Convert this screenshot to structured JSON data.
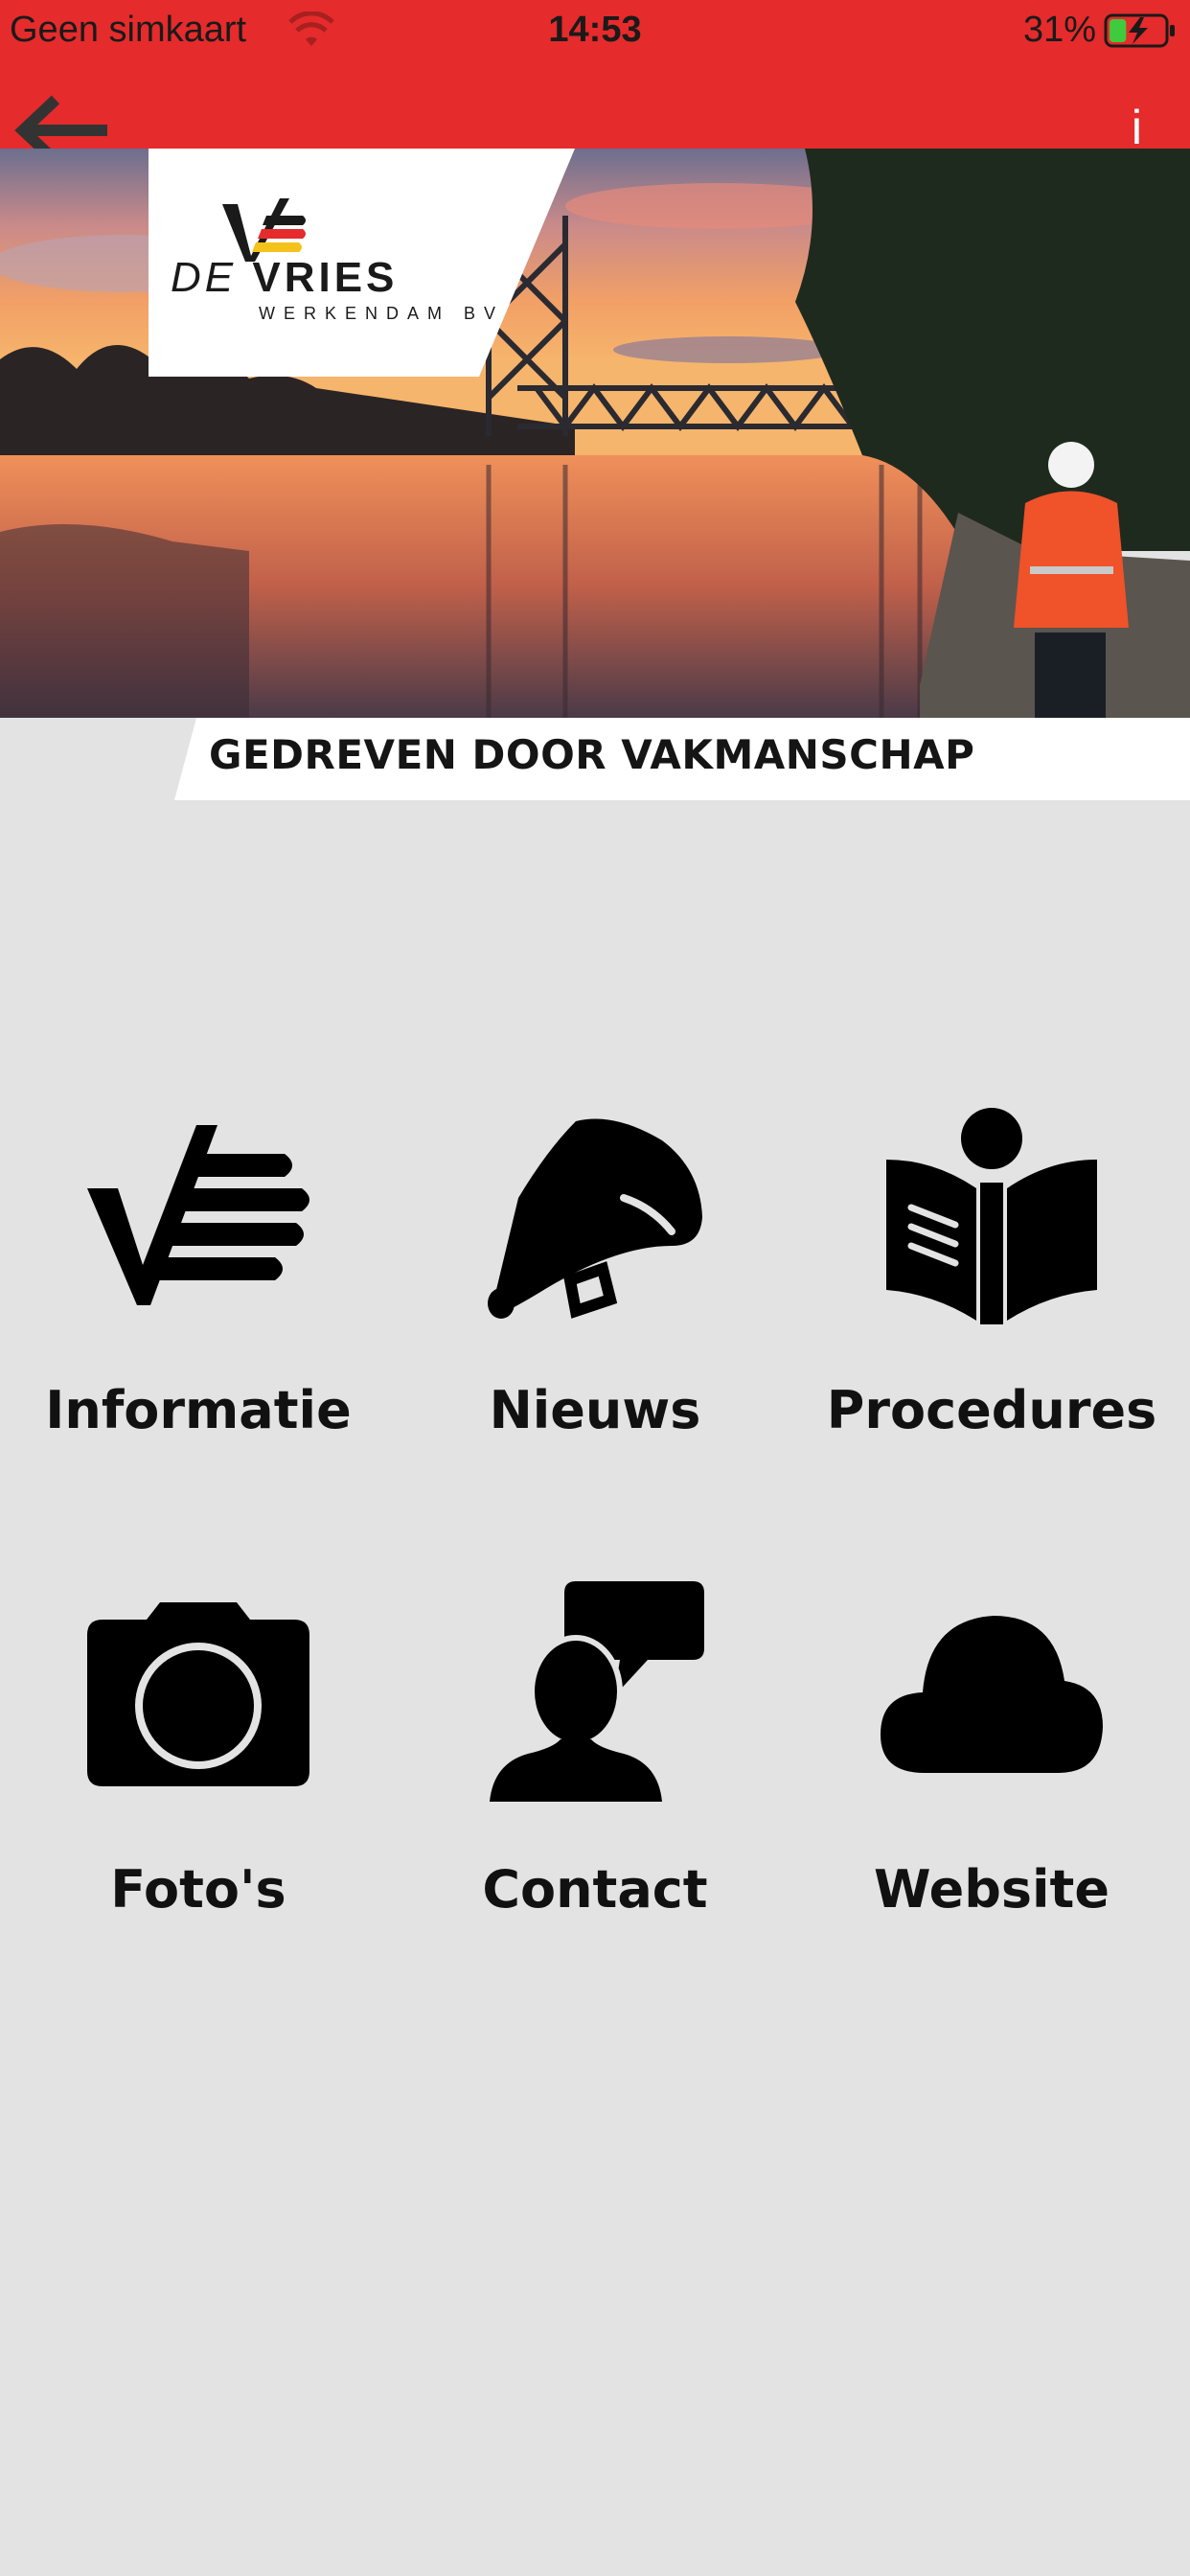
{
  "status_bar": {
    "carrier": "Geen simkaart",
    "time": "14:53",
    "battery_percent": "31%",
    "battery_level": 0.31
  },
  "nav": {
    "info_label": "i"
  },
  "hero": {
    "logo_brand_de": "DE",
    "logo_brand_vries": "VRIES",
    "logo_sub": "WERKENDAM BV",
    "tagline": "GEDREVEN DOOR VAKMANSCHAP"
  },
  "menu": [
    {
      "label": "Informatie",
      "icon": "check-stripes-icon"
    },
    {
      "label": "Nieuws",
      "icon": "megaphone-icon"
    },
    {
      "label": "Procedures",
      "icon": "book-info-icon"
    },
    {
      "label": "Foto's",
      "icon": "camera-icon"
    },
    {
      "label": "Contact",
      "icon": "person-speech-icon"
    },
    {
      "label": "Website",
      "icon": "cloud-icon"
    }
  ],
  "colors": {
    "nav_red": "#e52b2b",
    "background": "#e3e3e3",
    "icon": "#000000",
    "flag_black": "#1a1a1a",
    "flag_red": "#e52b2b",
    "flag_yellow": "#f4c21a"
  }
}
